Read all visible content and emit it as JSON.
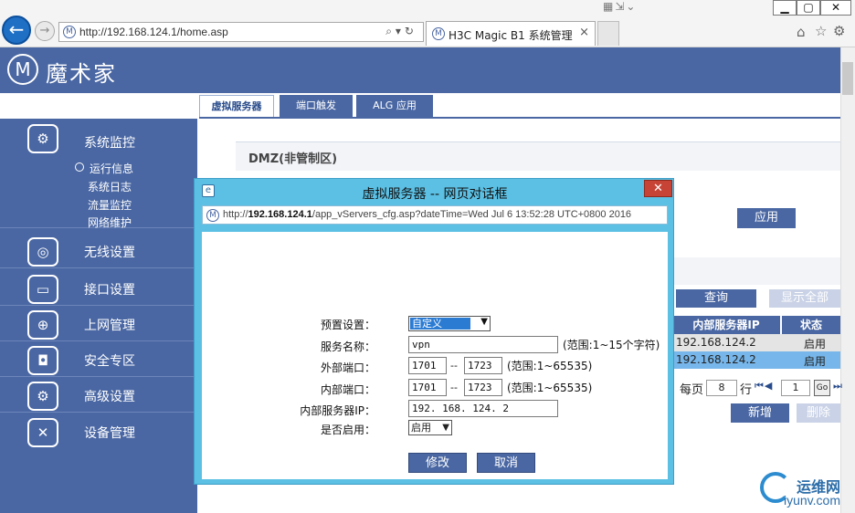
{
  "browser": {
    "url": "http://192.168.124.1/home.asp",
    "url_prefix": "http://",
    "tab_title": "H3C Magic B1 系统管理",
    "back_glyph": "←",
    "forward_glyph": "→",
    "tab_close": "×",
    "win_min": "▁",
    "win_max": "▢",
    "win_close": "✕"
  },
  "app": {
    "logo_glyph": "M",
    "logo_text": "魔术家"
  },
  "page_tabs": [
    {
      "label": "虚拟服务器",
      "active": true
    },
    {
      "label": "端口触发",
      "active": false
    },
    {
      "label": "ALG 应用",
      "active": false
    }
  ],
  "sidebar": {
    "sections": [
      {
        "label": "系统监控",
        "icon": "gear-monitor-icon"
      },
      {
        "label": "无线设置",
        "icon": "wifi-icon"
      },
      {
        "label": "接口设置",
        "icon": "interface-icon"
      },
      {
        "label": "上网管理",
        "icon": "globe-icon"
      },
      {
        "label": "安全专区",
        "icon": "lock-shield-icon"
      },
      {
        "label": "高级设置",
        "icon": "gear-icon"
      },
      {
        "label": "设备管理",
        "icon": "device-manage-icon"
      }
    ],
    "subitems": [
      "运行信息",
      "系统日志",
      "流量监控",
      "网络维护"
    ]
  },
  "main": {
    "dmz_title": "DMZ(非管制区)",
    "apply": "应用",
    "query": "查询",
    "show_all": "显示全部",
    "table_headers": [
      "内部服务器IP",
      "状态"
    ],
    "rows": [
      {
        "ip": "192.168.124.2",
        "status": "启用"
      },
      {
        "ip": "192.168.124.2",
        "status": "启用"
      }
    ],
    "per_page_label": "每页",
    "per_page_value": "8",
    "row_label": "行",
    "page_value": "1",
    "go": "Go",
    "add": "新增",
    "delete": "删除"
  },
  "dialog": {
    "title": "虚拟服务器 -- 网页对话框",
    "url_prefix": "http://",
    "url_host": "192.168.124.1",
    "url_rest": "/app_vServers_cfg.asp?dateTime=Wed Jul 6 13:52:28 UTC+0800 2016",
    "close": "✕",
    "fields": {
      "preset": {
        "label": "预置设置：",
        "value": "自定义"
      },
      "service_name": {
        "label": "服务名称：",
        "value": "vpn",
        "hint": "(范围:1~15个字符)"
      },
      "external_port": {
        "label": "外部端口：",
        "from": "1701",
        "to": "1723",
        "hint": "(范围:1~65535)"
      },
      "internal_port": {
        "label": "内部端口：",
        "from": "1701",
        "to": "1723",
        "hint": "(范围:1~65535)"
      },
      "internal_ip": {
        "label": "内部服务器IP：",
        "value": "192. 168. 124. 2"
      },
      "enabled": {
        "label": "是否启用：",
        "value": "启用"
      }
    },
    "dash": "--",
    "modify": "修改",
    "cancel": "取消"
  },
  "watermark": {
    "line1": "运维网",
    "line2": "iyunv.com"
  }
}
